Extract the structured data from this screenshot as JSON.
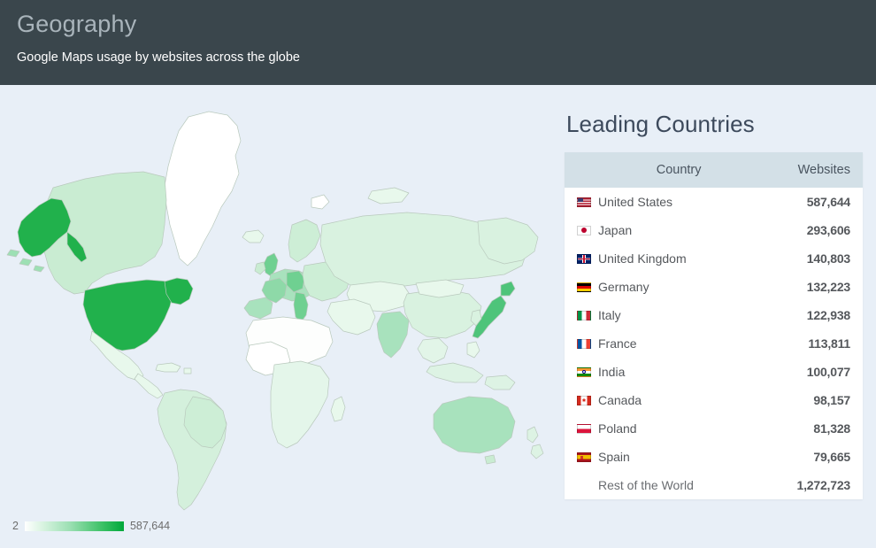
{
  "header": {
    "title": "Geography",
    "subtitle": "Google Maps usage by websites across the globe"
  },
  "map": {
    "legend": {
      "min_label": "2",
      "max_label": "587,644",
      "gradient_start": "#ffffff",
      "gradient_end": "#00a83a"
    },
    "ocean_color": "#e8eff7",
    "highlight_color": "#21b14c",
    "no_data_color": "#ffffff"
  },
  "table": {
    "heading": "Leading Countries",
    "columns": [
      "Country",
      "Websites"
    ],
    "rows": [
      {
        "flag": "flag-us",
        "country": "United States",
        "value": "587,644"
      },
      {
        "flag": "flag-jp",
        "country": "Japan",
        "value": "293,606"
      },
      {
        "flag": "flag-gb",
        "country": "United Kingdom",
        "value": "140,803"
      },
      {
        "flag": "flag-de",
        "country": "Germany",
        "value": "132,223"
      },
      {
        "flag": "flag-it",
        "country": "Italy",
        "value": "122,938"
      },
      {
        "flag": "flag-fr",
        "country": "France",
        "value": "113,811"
      },
      {
        "flag": "flag-in",
        "country": "India",
        "value": "100,077"
      },
      {
        "flag": "flag-ca",
        "country": "Canada",
        "value": "98,157"
      },
      {
        "flag": "flag-pl",
        "country": "Poland",
        "value": "81,328"
      },
      {
        "flag": "flag-es",
        "country": "Spain",
        "value": "79,665"
      },
      {
        "flag": "",
        "country": "Rest of the World",
        "value": "1,272,723"
      }
    ]
  },
  "chart_data": {
    "type": "map",
    "title": "Geography",
    "subtitle": "Google Maps usage by websites across the globe",
    "metric": "Websites",
    "color_scale": {
      "min": 2,
      "max": 587644,
      "low_color": "#ffffff",
      "high_color": "#00a83a"
    },
    "categories": [
      "United States",
      "Japan",
      "United Kingdom",
      "Germany",
      "Italy",
      "France",
      "India",
      "Canada",
      "Poland",
      "Spain",
      "Rest of the World"
    ],
    "values": [
      587644,
      293606,
      140803,
      132223,
      122938,
      113811,
      100077,
      98157,
      81328,
      79665,
      1272723
    ]
  }
}
